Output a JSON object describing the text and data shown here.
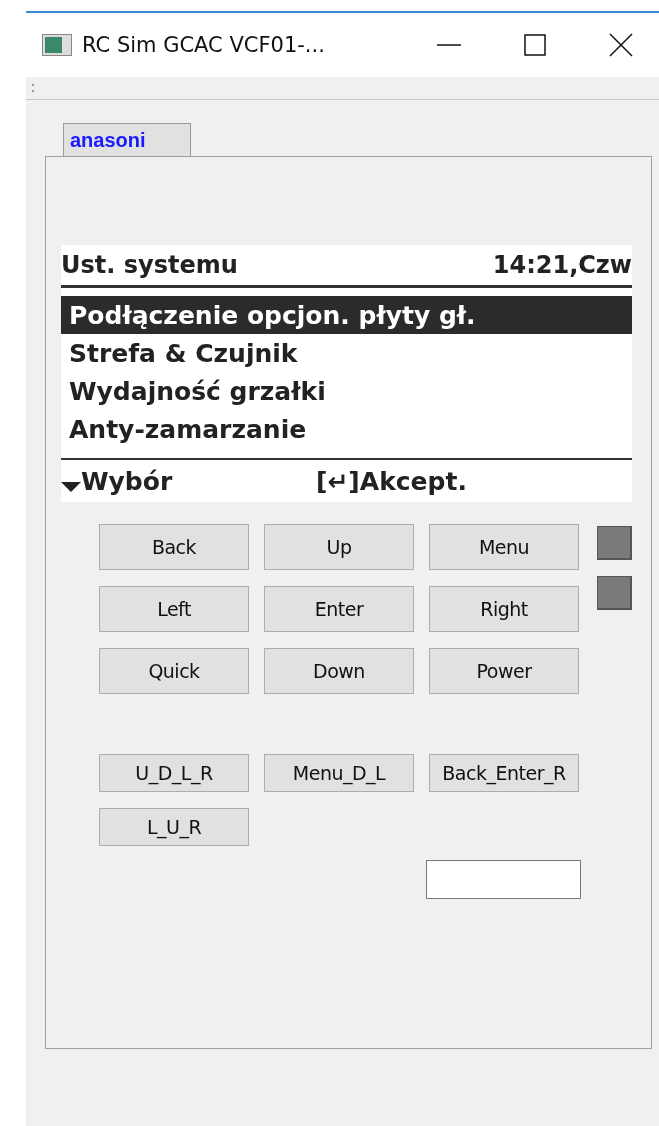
{
  "window": {
    "title": "RC Sim GCAC VCF01-..."
  },
  "tabs": [
    {
      "label": "anasoni",
      "selected": true
    }
  ],
  "display": {
    "title": "Ust. systemu",
    "clock": "14:21,Czw",
    "menu": [
      {
        "label": "Podłączenie opcjon. płyty gł.",
        "selected": true
      },
      {
        "label": "Strefa & Czujnik",
        "selected": false
      },
      {
        "label": "Wydajność grzałki",
        "selected": false
      },
      {
        "label": "Anty-zamarzanie",
        "selected": false
      }
    ],
    "footer_left": "Wybór",
    "footer_right": "[↵]Akcept."
  },
  "buttons": [
    {
      "label": "Back"
    },
    {
      "label": "Up"
    },
    {
      "label": "Menu"
    },
    {
      "label": "Left"
    },
    {
      "label": "Enter"
    },
    {
      "label": "Right"
    },
    {
      "label": "Quick"
    },
    {
      "label": "Down"
    },
    {
      "label": "Power"
    }
  ],
  "combo_buttons": [
    {
      "label": "U_D_L_R"
    },
    {
      "label": "Menu_D_L"
    },
    {
      "label": "Back_Enter_R"
    },
    {
      "label": "L_U_R"
    }
  ],
  "indicators": [
    {
      "color": "#7a7a7a"
    },
    {
      "color": "#7a7a7a"
    }
  ]
}
